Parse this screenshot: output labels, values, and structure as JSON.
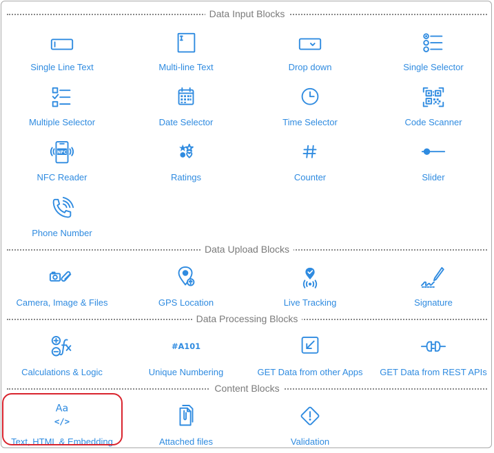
{
  "sections": {
    "input": "Data Input Blocks",
    "upload": "Data Upload Blocks",
    "processing": "Data Processing Blocks",
    "content": "Content Blocks"
  },
  "blocks": {
    "single_line_text": "Single Line Text",
    "multi_line_text": "Multi-line Text",
    "drop_down": "Drop down",
    "single_selector": "Single Selector",
    "multiple_selector": "Multiple Selector",
    "date_selector": "Date Selector",
    "time_selector": "Time Selector",
    "code_scanner": "Code Scanner",
    "nfc_reader": "NFC Reader",
    "ratings": "Ratings",
    "counter": "Counter",
    "slider": "Slider",
    "phone_number": "Phone Number",
    "camera_image_files": "Camera, Image & Files",
    "gps_location": "GPS Location",
    "live_tracking": "Live Tracking",
    "signature": "Signature",
    "calculations_logic": "Calculations & Logic",
    "unique_numbering": "Unique Numbering",
    "get_data_other_apps": "GET Data from other Apps",
    "get_data_rest_apis": "GET Data from REST APIs",
    "text_html_embedding": "Text, HTML & Embedding",
    "attached_files": "Attached files",
    "validation": "Validation"
  },
  "icon_text": {
    "nfc": "NFC",
    "numbering": "#A101",
    "font_sample": "Aa",
    "code_sample": "</>"
  },
  "colors": {
    "accent": "#2f8be0",
    "highlight": "#d9232d"
  }
}
